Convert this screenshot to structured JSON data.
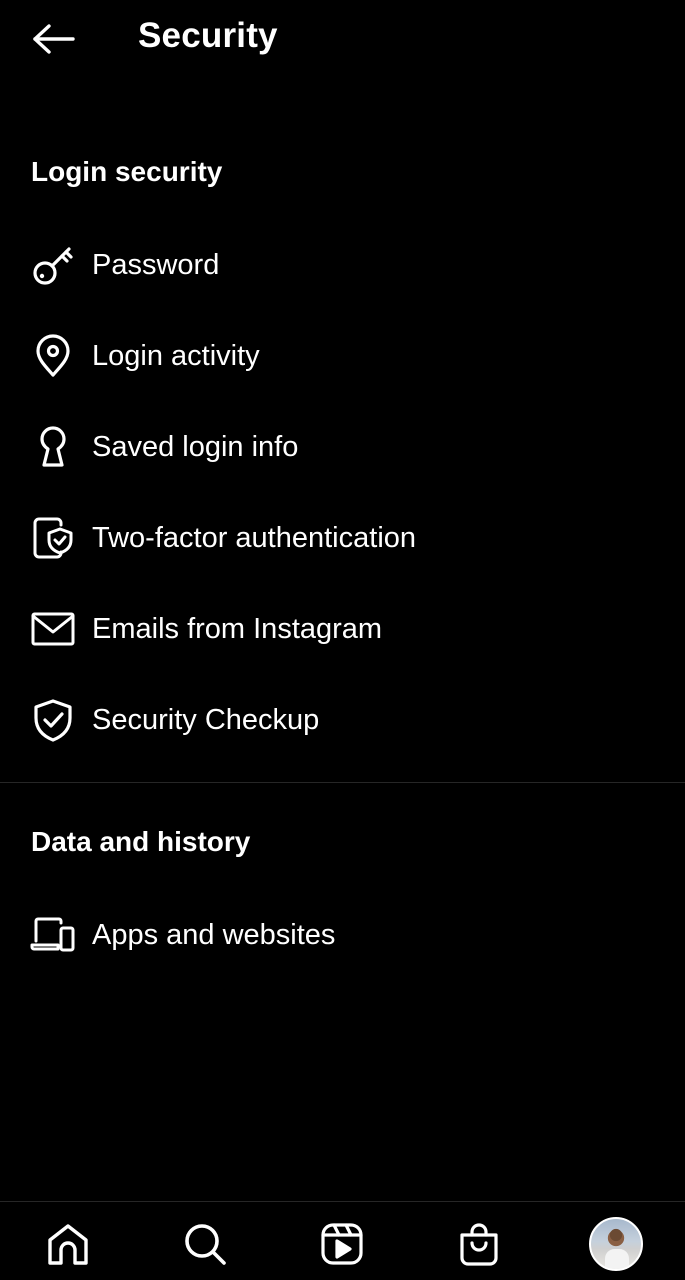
{
  "header": {
    "title": "Security",
    "back_icon": "arrow-left-icon"
  },
  "sections": [
    {
      "title": "Login security",
      "items": [
        {
          "label": "Password",
          "icon": "key-icon"
        },
        {
          "label": "Login activity",
          "icon": "location-pin-icon"
        },
        {
          "label": "Saved login info",
          "icon": "keyhole-icon"
        },
        {
          "label": "Two-factor authentication",
          "icon": "phone-shield-icon"
        },
        {
          "label": "Emails from Instagram",
          "icon": "envelope-icon"
        },
        {
          "label": "Security Checkup",
          "icon": "shield-check-icon"
        }
      ]
    },
    {
      "title": "Data and history",
      "items": [
        {
          "label": "Apps and websites",
          "icon": "devices-icon"
        }
      ]
    }
  ],
  "tabbar": {
    "items": [
      {
        "name": "home",
        "icon": "home-icon"
      },
      {
        "name": "search",
        "icon": "search-icon"
      },
      {
        "name": "reels",
        "icon": "reels-icon"
      },
      {
        "name": "shop",
        "icon": "shopping-bag-icon"
      },
      {
        "name": "profile",
        "icon": "profile-avatar"
      }
    ]
  },
  "colors": {
    "background": "#000000",
    "text": "#ffffff",
    "divider": "#262626"
  }
}
